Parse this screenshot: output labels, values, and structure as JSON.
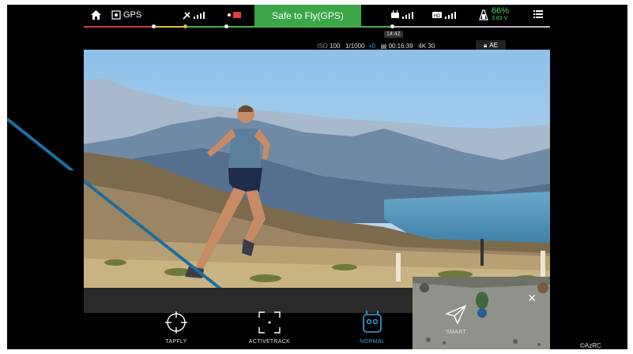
{
  "topbar": {
    "home_icon": "home-icon",
    "gps_label": "GPS",
    "status": "Safe to Fly(GPS)",
    "battery_percent": "66%",
    "battery_voltage": "3.83 V",
    "flight_time": "14:42",
    "colors": {
      "status_green": "#3ba748",
      "battery_green": "#4cd964"
    }
  },
  "camera": {
    "iso": "100",
    "shutter": "1/1000",
    "ev": "+0",
    "remaining": "00:16:39",
    "resolution": "4K 30",
    "exposure_lock": "AE"
  },
  "modes": [
    {
      "label": "TAPFLY",
      "icon": "crosshair-icon",
      "active": false
    },
    {
      "label": "ACTIVETRACK",
      "icon": "track-frame-icon",
      "active": false
    },
    {
      "label": "NORMAL",
      "icon": "remote-controller-icon",
      "active": true
    },
    {
      "label": "SMART",
      "icon": "paper-plane-icon",
      "active": false
    }
  ],
  "minimap": {
    "close": "×"
  },
  "watermark": "©AzRC"
}
